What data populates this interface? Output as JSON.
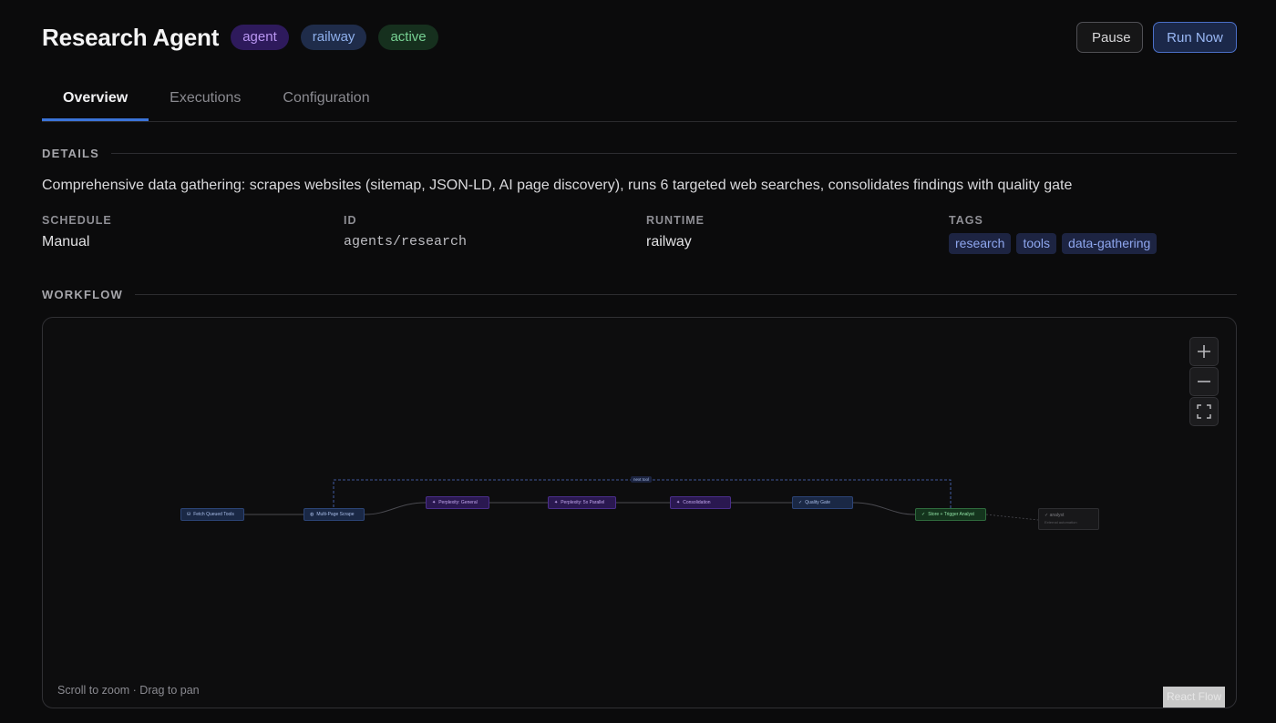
{
  "header": {
    "title": "Research Agent",
    "badges": {
      "agent": "agent",
      "railway": "railway",
      "active": "active"
    },
    "pause_label": "Pause",
    "run_label": "Run Now"
  },
  "tabs": [
    {
      "label": "Overview",
      "active": true
    },
    {
      "label": "Executions",
      "active": false
    },
    {
      "label": "Configuration",
      "active": false
    }
  ],
  "details": {
    "section_label": "DETAILS",
    "description": "Comprehensive data gathering: scrapes websites (sitemap, JSON-LD, AI page discovery), runs 6 targeted web searches, consolidates findings with quality gate",
    "schedule_label": "SCHEDULE",
    "schedule_value": "Manual",
    "id_label": "ID",
    "id_value": "agents/research",
    "runtime_label": "RUNTIME",
    "runtime_value": "railway",
    "tags_label": "TAGS",
    "tags": [
      "research",
      "tools",
      "data-gathering"
    ]
  },
  "workflow": {
    "section_label": "WORKFLOW",
    "hint": "Scroll to zoom · Drag to pan",
    "attribution": "React Flow",
    "edge_label": "next tool",
    "nodes": {
      "fetch": "Fetch Queued Tools",
      "scrape": "Multi-Page Scrape",
      "ppx_general": "Perplexity: General",
      "ppx_parallel": "Perplexity: 5x Parallel",
      "consolidation": "Consolidation",
      "quality": "Quality Gate",
      "store": "Store + Trigger Analyst",
      "analyst": "analyst",
      "analyst_sub": "External automation"
    }
  },
  "colors": {
    "accent": "#3b74d9",
    "background": "#0b0b0c"
  }
}
